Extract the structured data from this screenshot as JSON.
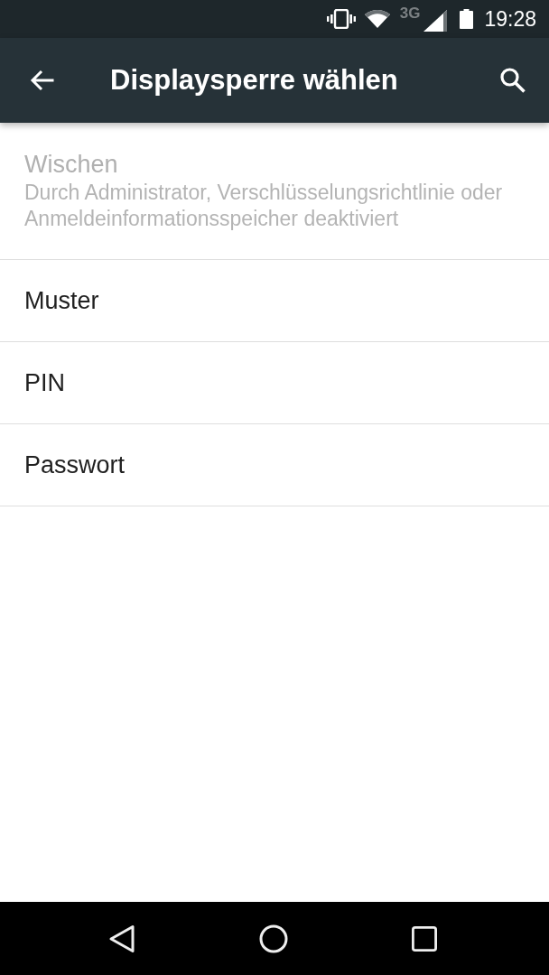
{
  "status_bar": {
    "network": "3G",
    "time": "19:28"
  },
  "toolbar": {
    "title": "Displaysperre wählen"
  },
  "options": [
    {
      "title": "Wischen",
      "summary": "Durch Administrator, Verschlüsselungsrichtlinie oder Anmeldeinformationsspeicher deaktiviert",
      "disabled": true
    },
    {
      "title": "Muster",
      "disabled": false
    },
    {
      "title": "PIN",
      "disabled": false
    },
    {
      "title": "Passwort",
      "disabled": false
    }
  ]
}
